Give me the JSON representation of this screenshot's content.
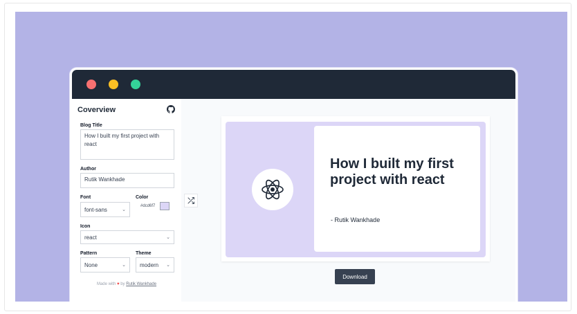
{
  "app": {
    "title": "Coverview"
  },
  "form": {
    "blog_title_label": "Blog Title",
    "blog_title_value": "How I built my first project with react",
    "author_label": "Author",
    "author_value": "Rutik Wankhade",
    "font_label": "Font",
    "font_value": "font-sans",
    "color_label": "Color",
    "color_value": "#dcd6f7",
    "icon_label": "Icon",
    "icon_value": "react",
    "pattern_label": "Pattern",
    "pattern_value": "None",
    "theme_label": "Theme",
    "theme_value": "modern"
  },
  "footer": {
    "made_with": "Made with",
    "by": "by",
    "author_link": "Rutik Wankhade"
  },
  "cover": {
    "title": "How I built my first project with react",
    "author": "- Rutik Wankhade",
    "icon": "react-icon",
    "background_color": "#dcd6f7"
  },
  "actions": {
    "download_label": "Download"
  },
  "colors": {
    "hero_bg": "#b3b3e6",
    "titlebar": "#1f2937",
    "dot_red": "#f87171",
    "dot_yellow": "#fbbf24",
    "dot_green": "#34d399"
  }
}
